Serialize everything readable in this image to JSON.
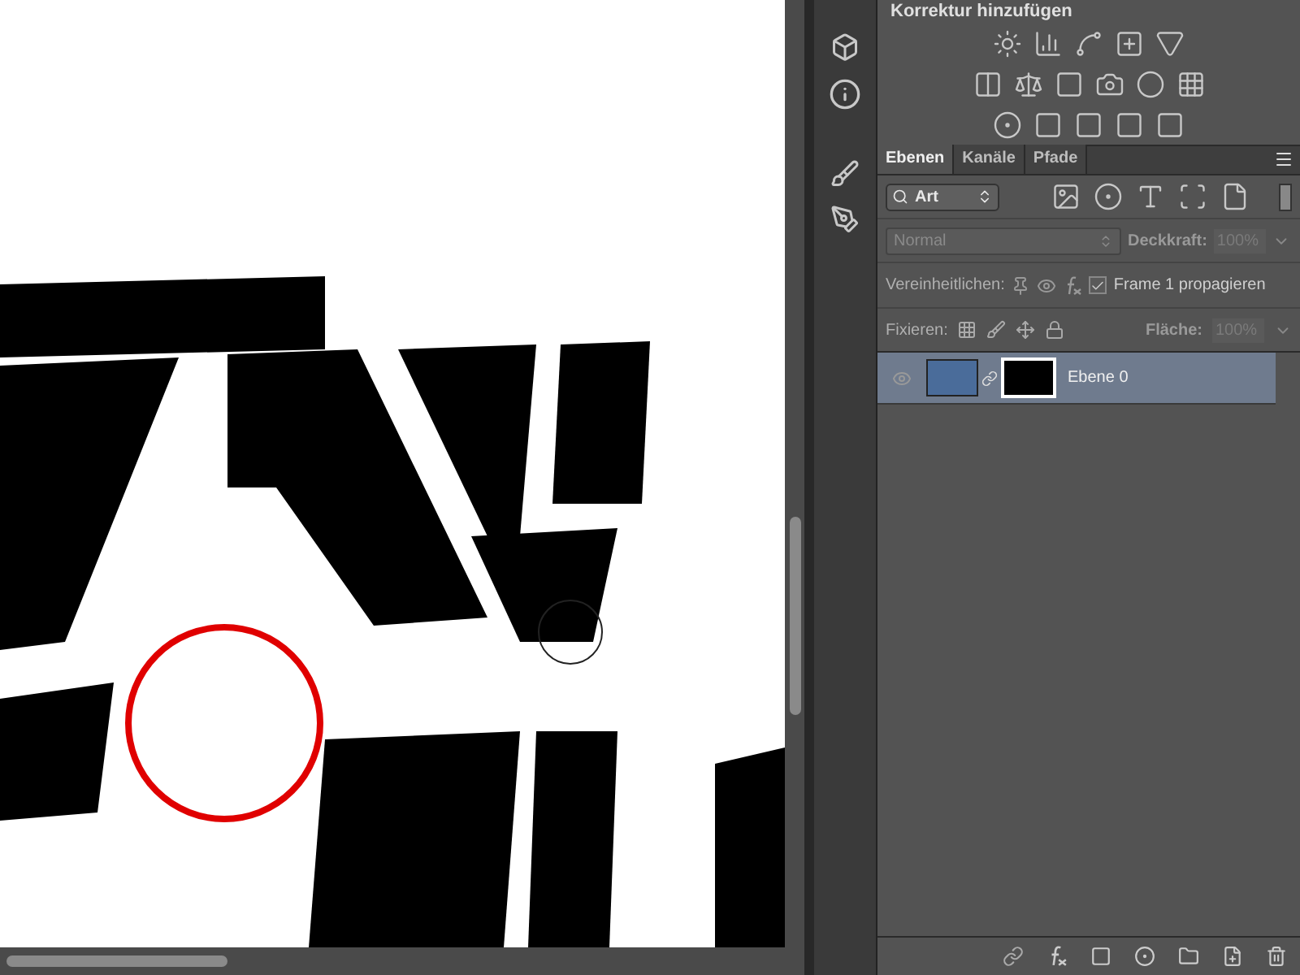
{
  "adjustments": {
    "title": "Korrektur hinzufügen"
  },
  "layers_panel": {
    "tabs": [
      {
        "label": "Ebenen",
        "selected": true
      },
      {
        "label": "Kanäle",
        "selected": false
      },
      {
        "label": "Pfade",
        "selected": false
      }
    ],
    "filter": {
      "value": "Art"
    },
    "blend_mode": {
      "value": "Normal",
      "disabled": true
    },
    "opacity": {
      "label": "Deckkraft:",
      "value": "100%",
      "disabled": true
    },
    "unify": {
      "label": "Vereinheitlichen:",
      "propagate": {
        "label": "Frame 1 propagieren",
        "checked": true
      }
    },
    "lock": {
      "label": "Fixieren:"
    },
    "fill": {
      "label": "Fläche:",
      "value": "100%",
      "disabled": true
    },
    "layers": [
      {
        "name": "Ebene 0",
        "selected": true,
        "visible": true
      }
    ]
  }
}
